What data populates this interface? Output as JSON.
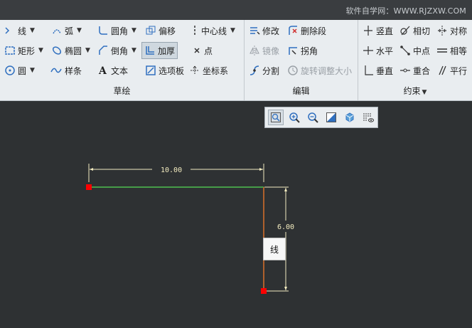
{
  "watermark": "软件自学网：WWW.RJZXW.COM",
  "groups": {
    "sketch": {
      "label": "草绘",
      "tools": {
        "line": "线",
        "arc": "弧",
        "fillet": "圆角",
        "offset": "偏移",
        "centerline": "中心线",
        "rectangle": "矩形",
        "ellipse": "椭圆",
        "chamfer": "倒角",
        "thicken": "加厚",
        "point": "点",
        "circle": "圆",
        "spline": "样条",
        "text": "文本",
        "palette": "选项板",
        "csys": "坐标系"
      }
    },
    "edit": {
      "label": "编辑",
      "tools": {
        "modify": "修改",
        "delete_segment": "删除段",
        "mirror": "镜像",
        "corner": "拐角",
        "divide": "分割",
        "rotate_resize": "旋转调整大小"
      }
    },
    "constraint": {
      "label": "约束",
      "tools": {
        "vertical": "竖直",
        "tangent": "相切",
        "symmetric": "对称",
        "horizontal": "水平",
        "midpoint": "中点",
        "equal": "相等",
        "perpendicular": "垂直",
        "coincident": "重合",
        "parallel": "平行"
      }
    }
  },
  "canvas": {
    "dim_horizontal": "10.00",
    "dim_vertical": "6.00",
    "tooltip": "线"
  },
  "colors": {
    "background": "#2e3133",
    "horizontal_line": "#4fc04f",
    "vertical_line": "#d9712a",
    "endpoint": "#ff0000",
    "dimension": "#f3ecc0"
  }
}
